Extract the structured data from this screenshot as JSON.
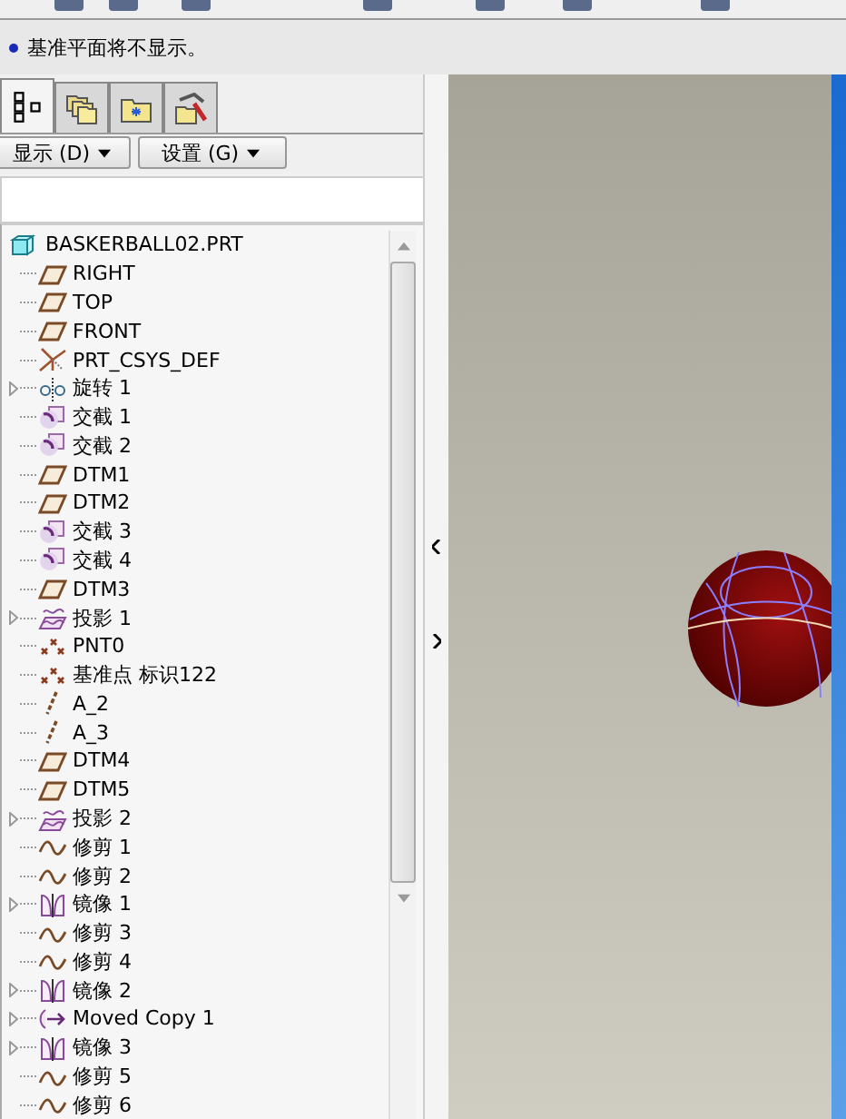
{
  "message": {
    "text": "基准平面将不显示。"
  },
  "tabs": [
    {
      "kind": "tree",
      "selected": true
    },
    {
      "kind": "folders",
      "selected": false
    },
    {
      "kind": "favorites",
      "selected": false
    },
    {
      "kind": "tools",
      "selected": false
    }
  ],
  "menu_buttons": [
    {
      "label": "显示 (D)"
    },
    {
      "label": "设置 (G)"
    }
  ],
  "tree": {
    "root": {
      "label": "BASKERBALL02.PRT",
      "kind": "part"
    },
    "items": [
      {
        "label": "RIGHT",
        "kind": "plane",
        "expandable": false
      },
      {
        "label": "TOP",
        "kind": "plane",
        "expandable": false
      },
      {
        "label": "FRONT",
        "kind": "plane",
        "expandable": false
      },
      {
        "label": "PRT_CSYS_DEF",
        "kind": "csys",
        "expandable": false
      },
      {
        "label": "旋转 1",
        "kind": "revolve",
        "expandable": true
      },
      {
        "label": "交截 1",
        "kind": "intersect",
        "expandable": false
      },
      {
        "label": "交截 2",
        "kind": "intersect",
        "expandable": false
      },
      {
        "label": "DTM1",
        "kind": "plane",
        "expandable": false
      },
      {
        "label": "DTM2",
        "kind": "plane",
        "expandable": false
      },
      {
        "label": "交截 3",
        "kind": "intersect",
        "expandable": false
      },
      {
        "label": "交截 4",
        "kind": "intersect",
        "expandable": false
      },
      {
        "label": "DTM3",
        "kind": "plane",
        "expandable": false
      },
      {
        "label": "投影 1",
        "kind": "project",
        "expandable": true
      },
      {
        "label": "PNT0",
        "kind": "point",
        "expandable": false
      },
      {
        "label": "基准点 标识122",
        "kind": "point",
        "expandable": false
      },
      {
        "label": "A_2",
        "kind": "axis",
        "expandable": false
      },
      {
        "label": "A_3",
        "kind": "axis",
        "expandable": false
      },
      {
        "label": "DTM4",
        "kind": "plane",
        "expandable": false
      },
      {
        "label": "DTM5",
        "kind": "plane",
        "expandable": false
      },
      {
        "label": "投影 2",
        "kind": "project",
        "expandable": true
      },
      {
        "label": "修剪 1",
        "kind": "curve",
        "expandable": false
      },
      {
        "label": "修剪 2",
        "kind": "curve",
        "expandable": false
      },
      {
        "label": "镜像 1",
        "kind": "mirror",
        "expandable": true
      },
      {
        "label": "修剪 3",
        "kind": "curve",
        "expandable": false
      },
      {
        "label": "修剪 4",
        "kind": "curve",
        "expandable": false
      },
      {
        "label": "镜像 2",
        "kind": "mirror",
        "expandable": true
      },
      {
        "label": "Moved Copy 1",
        "kind": "move",
        "expandable": true
      },
      {
        "label": "镜像 3",
        "kind": "mirror",
        "expandable": true
      },
      {
        "label": "修剪 5",
        "kind": "curve",
        "expandable": false
      },
      {
        "label": "修剪 6",
        "kind": "curve",
        "expandable": false
      }
    ]
  }
}
